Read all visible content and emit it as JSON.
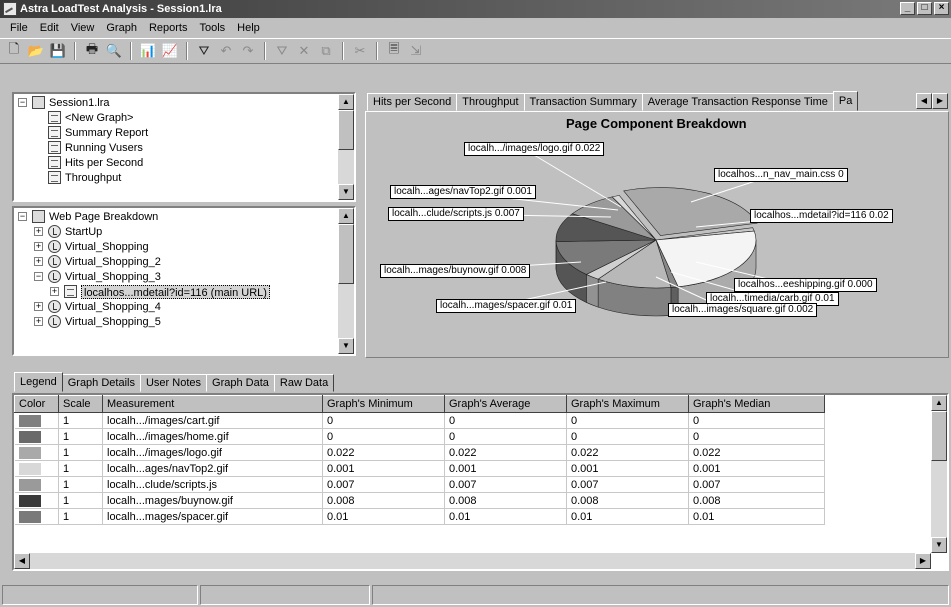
{
  "window": {
    "title": "Astra LoadTest Analysis - Session1.lra",
    "controls": [
      "_",
      "□",
      "×"
    ]
  },
  "menu": [
    "File",
    "Edit",
    "View",
    "Graph",
    "Reports",
    "Tools",
    "Help"
  ],
  "toolbar": [
    {
      "name": "new-icon",
      "glyph": "🗋"
    },
    {
      "name": "open-icon",
      "glyph": "📂"
    },
    {
      "name": "save-icon",
      "glyph": "💾"
    },
    {
      "sep": true
    },
    {
      "name": "print-icon",
      "glyph": "🖶"
    },
    {
      "name": "print-preview-icon",
      "glyph": "🔍"
    },
    {
      "sep": true
    },
    {
      "name": "add-graph-icon",
      "glyph": "📊"
    },
    {
      "name": "graph-properties-icon",
      "glyph": "📈"
    },
    {
      "sep": true
    },
    {
      "name": "filter-icon",
      "glyph": "⛛"
    },
    {
      "name": "undo-icon",
      "glyph": "↶",
      "dim": true
    },
    {
      "name": "redo-icon",
      "glyph": "↷",
      "dim": true
    },
    {
      "sep": true
    },
    {
      "name": "set-filter-icon",
      "glyph": "⛛",
      "dim": true
    },
    {
      "name": "clear-filter-icon",
      "glyph": "✕",
      "dim": true
    },
    {
      "name": "merge-graphs-icon",
      "glyph": "⧉",
      "dim": true
    },
    {
      "sep": true
    },
    {
      "name": "cut-icon",
      "glyph": "✂",
      "dim": true
    },
    {
      "sep": true
    },
    {
      "name": "report-icon",
      "glyph": "🗏"
    },
    {
      "name": "export-icon",
      "glyph": "⇲",
      "dim": true
    }
  ],
  "session_tree": [
    {
      "label": "Session1.lra",
      "level": 0,
      "icon": "folder",
      "pm": "-"
    },
    {
      "label": "<New Graph>",
      "level": 1,
      "icon": "doc"
    },
    {
      "label": "Summary Report",
      "level": 1,
      "icon": "doc"
    },
    {
      "label": "Running Vusers",
      "level": 1,
      "icon": "doc"
    },
    {
      "label": "Hits per Second",
      "level": 1,
      "icon": "doc"
    },
    {
      "label": "Throughput",
      "level": 1,
      "icon": "doc"
    }
  ],
  "breakdown_tree": [
    {
      "label": "Web Page Breakdown",
      "level": 0,
      "icon": "folder",
      "pm": "-"
    },
    {
      "label": "StartUp",
      "level": 1,
      "icon": "trans",
      "pm": "+"
    },
    {
      "label": "Virtual_Shopping",
      "level": 1,
      "icon": "trans",
      "pm": "+"
    },
    {
      "label": "Virtual_Shopping_2",
      "level": 1,
      "icon": "trans",
      "pm": "+"
    },
    {
      "label": "Virtual_Shopping_3",
      "level": 1,
      "icon": "trans",
      "pm": "-"
    },
    {
      "label": "localhos...mdetail?id=116 (main URL)",
      "level": 2,
      "icon": "doc",
      "pm": "+",
      "selected": true
    },
    {
      "label": "Virtual_Shopping_4",
      "level": 1,
      "icon": "trans",
      "pm": "+"
    },
    {
      "label": "Virtual_Shopping_5",
      "level": 1,
      "icon": "trans",
      "pm": "+"
    }
  ],
  "graph_tabs": [
    "Hits per Second",
    "Throughput",
    "Transaction Summary",
    "Average Transaction Response Time",
    "Pa"
  ],
  "chart_data": {
    "type": "pie",
    "title": "Page Component Breakdown",
    "slices": [
      {
        "label": "localh.../images/logo.gif 0.022",
        "value": 0.022,
        "color": "#a9a9a9"
      },
      {
        "label": "localhos...n_nav_main.css 0",
        "value": 0,
        "color": "#c8c8c8"
      },
      {
        "label": "localhos...mdetail?id=116 0.02",
        "value": 0.02,
        "color": "#f4f4f4"
      },
      {
        "label": "localhos...eeshipping.gif 0.000",
        "value": 0.0,
        "color": "#888888"
      },
      {
        "label": "localh...timedia/carb.gif 0.01",
        "value": 0.01,
        "color": "#b8b8b8"
      },
      {
        "label": "localh...images/square.gif 0.002",
        "value": 0.002,
        "color": "#d0d0d0"
      },
      {
        "label": "localh...mages/spacer.gif 0.01",
        "value": 0.01,
        "color": "#7a7a7a"
      },
      {
        "label": "localh...mages/buynow.gif 0.008",
        "value": 0.008,
        "color": "#555555"
      },
      {
        "label": "localh...clude/scripts.js 0.007",
        "value": 0.007,
        "color": "#9a9a9a"
      },
      {
        "label": "localh...ages/navTop2.gif 0.001",
        "value": 0.001,
        "color": "#d8d8d8"
      }
    ]
  },
  "bottom_tabs": [
    "Legend",
    "Graph Details",
    "User Notes",
    "Graph Data",
    "Raw Data"
  ],
  "legend": {
    "columns": [
      "Color",
      "Scale",
      "Measurement",
      "Graph's Minimum",
      "Graph's Average",
      "Graph's Maximum",
      "Graph's Median"
    ],
    "rows": [
      {
        "color": "#808080",
        "scale": "1",
        "measurement": "localh.../images/cart.gif",
        "min": "0",
        "avg": "0",
        "max": "0",
        "median": "0"
      },
      {
        "color": "#6a6a6a",
        "scale": "1",
        "measurement": "localh.../images/home.gif",
        "min": "0",
        "avg": "0",
        "max": "0",
        "median": "0"
      },
      {
        "color": "#a9a9a9",
        "scale": "1",
        "measurement": "localh.../images/logo.gif",
        "min": "0.022",
        "avg": "0.022",
        "max": "0.022",
        "median": "0.022"
      },
      {
        "color": "#d8d8d8",
        "scale": "1",
        "measurement": "localh...ages/navTop2.gif",
        "min": "0.001",
        "avg": "0.001",
        "max": "0.001",
        "median": "0.001"
      },
      {
        "color": "#9a9a9a",
        "scale": "1",
        "measurement": "localh...clude/scripts.js",
        "min": "0.007",
        "avg": "0.007",
        "max": "0.007",
        "median": "0.007"
      },
      {
        "color": "#3a3a3a",
        "scale": "1",
        "measurement": "localh...mages/buynow.gif",
        "min": "0.008",
        "avg": "0.008",
        "max": "0.008",
        "median": "0.008"
      },
      {
        "color": "#7a7a7a",
        "scale": "1",
        "measurement": "localh...mages/spacer.gif",
        "min": "0.01",
        "avg": "0.01",
        "max": "0.01",
        "median": "0.01"
      }
    ]
  },
  "status": [
    "",
    "",
    ""
  ]
}
